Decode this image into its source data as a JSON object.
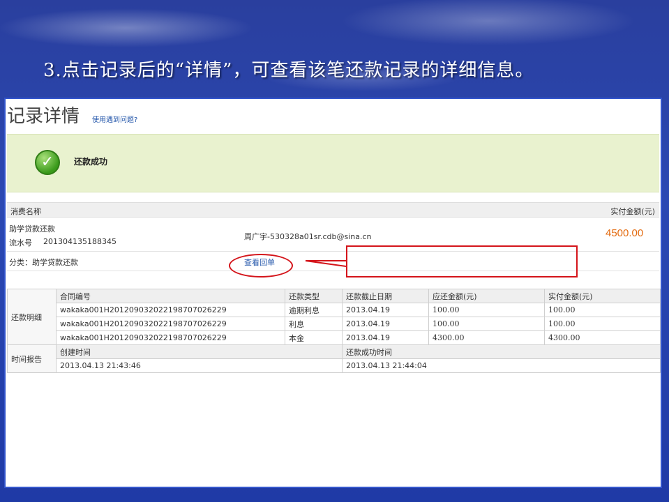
{
  "slide": {
    "caption": "3.点击记录后的“详情”，可查看该笔还款记录的详细信息。"
  },
  "page": {
    "title": "记录详情",
    "help_link": "使用遇到问题?"
  },
  "status": {
    "text": "还款成功",
    "icon": "check-icon"
  },
  "consumption": {
    "name_header": "消费名称",
    "amount_header": "实付金额(元)",
    "item_name": "助学贷款还款",
    "serial_label": "流水号",
    "serial_value": "201304135188345",
    "counterparty": "周广宇-530328a01sr.cdb@sina.cn",
    "amount": "4500.00",
    "category": "分类：助学贷款还款",
    "receipt_link": "查看回单"
  },
  "repayment_detail": {
    "section_label": "还款明细",
    "headers": [
      "合同编号",
      "还款类型",
      "还款截止日期",
      "应还金额(元)",
      "实付金额(元)"
    ],
    "rows": [
      [
        "wakaka001H20120903202219870702622​9",
        "逾期利息",
        "2013.04.19",
        "100.00",
        "100.00"
      ],
      [
        "wakaka001H201209032022198707026229",
        "利息",
        "2013.04.19",
        "100.00",
        "100.00"
      ],
      [
        "wakaka001H201209032022198707026229",
        "本金",
        "2013.04.19",
        "4300.00",
        "4300.00"
      ]
    ]
  },
  "time_report": {
    "section_label": "时间报告",
    "created_header": "创建时间",
    "success_header": "还款成功时间",
    "created_value": "2013.04.13 21:43:46",
    "success_value": "2013.04.13 21:44:04"
  },
  "colors": {
    "accent_red": "#d4141a",
    "amount_orange": "#e36b10",
    "success_bg": "#e9f2cf",
    "link_blue": "#2255aa"
  }
}
